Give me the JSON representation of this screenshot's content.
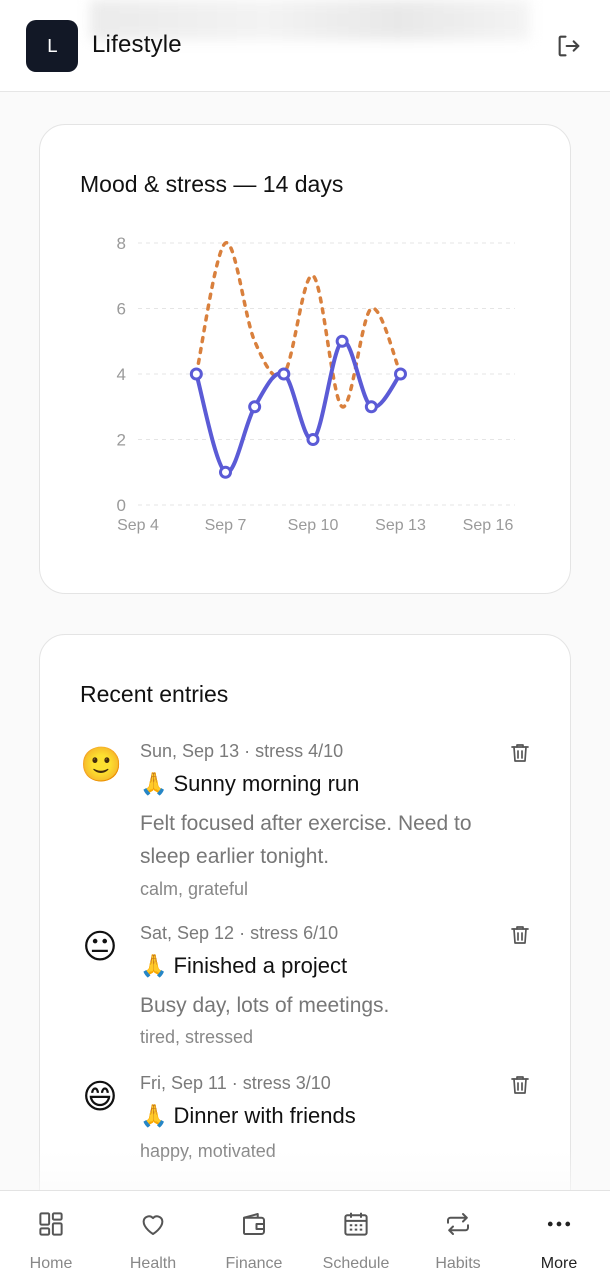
{
  "header": {
    "logo_letter": "L",
    "title": "Lifestyle",
    "logout_icon": "logout-icon"
  },
  "chart_card": {
    "title": "Mood & stress — 14 days"
  },
  "chart_data": {
    "type": "line",
    "title": "Mood & stress — 14 days",
    "x_ticks": [
      "Sep 4",
      "Sep 7",
      "Sep 10",
      "Sep 13",
      "Sep 16"
    ],
    "y_ticks": [
      "0",
      "2",
      "4",
      "6",
      "8"
    ],
    "ylim": [
      0,
      8
    ],
    "xlim": [
      "Sep 4",
      "Sep 16"
    ],
    "grid": true,
    "series": [
      {
        "style": "solid",
        "color": "#5b5bd6",
        "markers": true,
        "points": [
          {
            "x": "Sep 6",
            "y": 4
          },
          {
            "x": "Sep 7",
            "y": 1
          },
          {
            "x": "Sep 8",
            "y": 3
          },
          {
            "x": "Sep 9",
            "y": 4
          },
          {
            "x": "Sep 10",
            "y": 2
          },
          {
            "x": "Sep 11",
            "y": 5
          },
          {
            "x": "Sep 12",
            "y": 3
          },
          {
            "x": "Sep 13",
            "y": 4
          }
        ]
      },
      {
        "style": "dashed",
        "color": "#d9803d",
        "markers": false,
        "points": [
          {
            "x": "Sep 6",
            "y": 4
          },
          {
            "x": "Sep 7",
            "y": 8
          },
          {
            "x": "Sep 8",
            "y": 5
          },
          {
            "x": "Sep 9",
            "y": 4
          },
          {
            "x": "Sep 10",
            "y": 7
          },
          {
            "x": "Sep 11",
            "y": 3
          },
          {
            "x": "Sep 12",
            "y": 6
          },
          {
            "x": "Sep 13",
            "y": 4
          }
        ]
      }
    ]
  },
  "entries_card": {
    "title": "Recent entries",
    "entries": [
      {
        "emoji": "🙂",
        "meta": "Sun, Sep 13 · stress 4/10",
        "title": "🙏 Sunny morning run",
        "note": "Felt focused after exercise. Need to sleep earlier tonight.",
        "tags": "calm, grateful"
      },
      {
        "emoji": "😐",
        "meta": "Sat, Sep 12 · stress 6/10",
        "title": "🙏 Finished a project",
        "note": "Busy day, lots of meetings.",
        "tags": "tired, stressed"
      },
      {
        "emoji": "😄",
        "meta": "Fri, Sep 11 · stress 3/10",
        "title": "🙏 Dinner with friends",
        "note": "",
        "tags": "happy, motivated"
      }
    ]
  },
  "bottom_nav": {
    "items": [
      {
        "label": "Home",
        "icon": "home-grid-icon",
        "active": false
      },
      {
        "label": "Health",
        "icon": "heart-icon",
        "active": false
      },
      {
        "label": "Finance",
        "icon": "wallet-icon",
        "active": false
      },
      {
        "label": "Schedule",
        "icon": "calendar-icon",
        "active": false
      },
      {
        "label": "Habits",
        "icon": "repeat-icon",
        "active": false
      },
      {
        "label": "More",
        "icon": "more-dots-icon",
        "active": true
      }
    ]
  }
}
